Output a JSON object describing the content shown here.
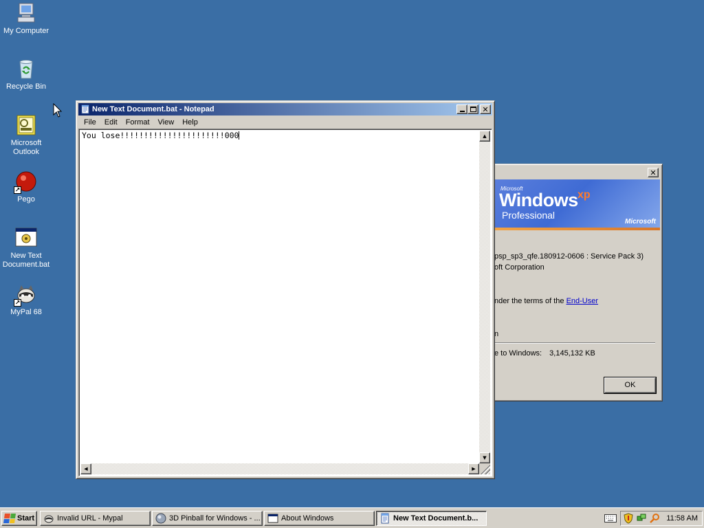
{
  "desktop": {
    "icons": [
      {
        "label": "My Computer",
        "icon": "my-computer-icon"
      },
      {
        "label": "Recycle Bin",
        "icon": "recycle-bin-icon"
      },
      {
        "label": "Microsoft Outlook",
        "icon": "outlook-icon"
      },
      {
        "label": "Pego",
        "icon": "pego-icon"
      },
      {
        "label": "New Text Document.bat",
        "icon": "batch-file-icon"
      },
      {
        "label": "MyPal 68",
        "icon": "mypal-icon"
      }
    ]
  },
  "notepad": {
    "title": "New Text Document.bat - Notepad",
    "menu": [
      "File",
      "Edit",
      "Format",
      "View",
      "Help"
    ],
    "content": "You lose!!!!!!!!!!!!!!!!!!!!!!000"
  },
  "about": {
    "banner": {
      "microsoft_small": "Microsoft",
      "windows": "Windows",
      "xp": "xp",
      "edition": "Professional",
      "microsoft_logo": "Microsoft"
    },
    "version_line": "psp_sp3_qfe.180912-0606 : Service Pack 3)",
    "copyright_line": "oft Corporation",
    "license_prefix": "nder the terms of the ",
    "license_link": "End-User",
    "licensee_line": "n",
    "memory_label": "e to Windows:",
    "memory_value": "3,145,132 KB",
    "ok_label": "OK"
  },
  "taskbar": {
    "start_label": "Start",
    "buttons": [
      {
        "label": "Invalid URL - Mypal",
        "icon": "mypal-icon",
        "active": false
      },
      {
        "label": "3D Pinball for Windows - ...",
        "icon": "pinball-icon",
        "active": false
      },
      {
        "label": "About Windows",
        "icon": "window-icon",
        "active": false
      },
      {
        "label": "New Text Document.b...",
        "icon": "notepad-icon",
        "active": true
      }
    ],
    "clock": "11:58 AM"
  },
  "colors": {
    "desktop": "#3a6ea5",
    "active_title_start": "#0a246a",
    "active_title_end": "#a6caf0",
    "xp_orange": "#ff7a2a"
  }
}
